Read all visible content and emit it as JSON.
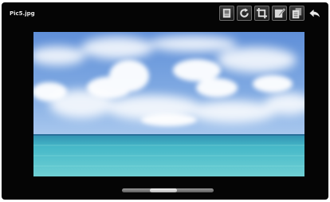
{
  "window": {
    "title": "Pic5.jpg"
  },
  "toolbar": {
    "buttons": [
      {
        "name": "set-as-icon"
      },
      {
        "name": "rotate-icon"
      },
      {
        "name": "crop-icon"
      },
      {
        "name": "edit-icon"
      },
      {
        "name": "details-icon"
      },
      {
        "name": "back-arrow-icon"
      }
    ]
  },
  "viewer": {
    "scrubber_position": 0.43
  },
  "colors": {
    "background": "#050505",
    "sky_top": "#5f8fd8",
    "sea": "#46b8c8"
  }
}
